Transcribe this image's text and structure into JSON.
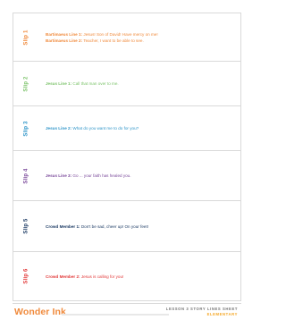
{
  "slips": [
    {
      "label": "Slip 1",
      "color": "#f08a3c",
      "lines": [
        {
          "speaker": "Bartimaeus Line 1:",
          "text": "Jesus! Son of David! Have mercy on me!"
        },
        {
          "speaker": "Bartimaeus Line 2:",
          "text": "Teacher, I want to be able to see."
        }
      ]
    },
    {
      "label": "Slip 2",
      "color": "#7cc36a",
      "lines": [
        {
          "speaker": "Jesus Line 1:",
          "text": "Call that man over to me."
        }
      ]
    },
    {
      "label": "Slip 3",
      "color": "#2d94c8",
      "lines": [
        {
          "speaker": "Jesus Line 2:",
          "text": "What do you want me to do for you?"
        }
      ]
    },
    {
      "label": "Slip 4",
      "color": "#7b4a9b",
      "lines": [
        {
          "speaker": "Jesus Line 3:",
          "text": "Go ... your faith has healed you."
        }
      ]
    },
    {
      "label": "Slip 5",
      "color": "#1f3d66",
      "lines": [
        {
          "speaker": "Crowd Member 1:",
          "text": "Don't be sad, cheer up! On your feet!"
        }
      ]
    },
    {
      "label": "Slip 6",
      "color": "#e23b3b",
      "lines": [
        {
          "speaker": "Crowd Member 2:",
          "text": "Jesus is calling for you!"
        }
      ]
    }
  ],
  "footer": {
    "brand": "Wonder Ink",
    "lesson": "LESSON 3 STORY LINES SHEET",
    "level": "ELEMENTARY"
  }
}
